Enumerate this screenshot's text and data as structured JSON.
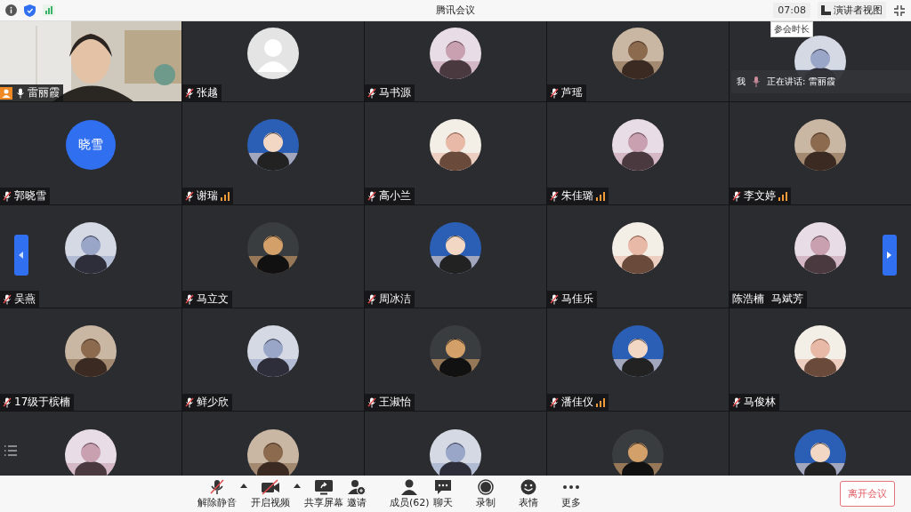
{
  "window": {
    "title": "腾讯会议",
    "timer": "07:08",
    "timer_tooltip": "参会时长",
    "view_button": "演讲者视图"
  },
  "participants": [
    {
      "name": "雷丽霞",
      "kind": "video",
      "muted": false,
      "host": true,
      "signal": false
    },
    {
      "name": "张越",
      "kind": "default",
      "muted": true,
      "host": false,
      "signal": false
    },
    {
      "name": "马书源",
      "kind": "picture",
      "muted": true,
      "host": false,
      "signal": false
    },
    {
      "name": "芦瑶",
      "kind": "picture",
      "muted": true,
      "host": false,
      "signal": false
    },
    {
      "kind": "picture"
    },
    {
      "name": "郭晓雪",
      "kind": "initials",
      "initials": "晓雪",
      "muted": true,
      "host": false,
      "signal": false
    },
    {
      "name": "谢瑞",
      "kind": "picture",
      "muted": true,
      "host": false,
      "signal": true
    },
    {
      "name": "高小兰",
      "kind": "picture",
      "muted": true,
      "host": false,
      "signal": false
    },
    {
      "name": "朱佳璐",
      "kind": "picture",
      "muted": true,
      "host": false,
      "signal": true
    },
    {
      "name": "李文婷",
      "kind": "picture",
      "muted": true,
      "host": false,
      "signal": true
    },
    {
      "name": "吴燕",
      "kind": "picture",
      "muted": true,
      "host": false,
      "signal": false
    },
    {
      "name": "马立文",
      "kind": "picture",
      "muted": true,
      "host": false,
      "signal": false
    },
    {
      "name": "周冰洁",
      "kind": "picture",
      "muted": true,
      "host": false,
      "signal": false
    },
    {
      "name": "马佳乐",
      "kind": "picture",
      "muted": true,
      "host": false,
      "signal": false
    },
    {
      "name": "陈浩楠  马斌芳",
      "kind": "picture",
      "host": false,
      "signal": false
    },
    {
      "name": "17级于槟楠",
      "kind": "picture",
      "muted": true,
      "host": false,
      "signal": false
    },
    {
      "name": "鲜少欣",
      "kind": "picture",
      "muted": true,
      "host": false,
      "signal": false
    },
    {
      "name": "王淑怡",
      "kind": "picture",
      "muted": true,
      "host": false,
      "signal": false
    },
    {
      "name": "潘佳仪",
      "kind": "picture",
      "muted": true,
      "host": false,
      "signal": true
    },
    {
      "name": "马俊林",
      "kind": "picture",
      "muted": true,
      "host": false,
      "signal": false
    },
    {
      "kind": "picture"
    },
    {
      "kind": "picture"
    },
    {
      "kind": "picture"
    },
    {
      "kind": "picture"
    },
    {
      "kind": "picture"
    }
  ],
  "speaking_popup": {
    "me": "我",
    "text": "正在讲话: 雷丽霞"
  },
  "toolbar": [
    {
      "kind": "mic",
      "label": "解除静音",
      "caret": true
    },
    {
      "kind": "video",
      "label": "开启视频",
      "caret": true
    },
    {
      "kind": "share",
      "label": "共享屏幕",
      "caret": false
    },
    {
      "kind": "invite",
      "label": "邀请",
      "caret": false
    },
    {
      "kind": "members",
      "label": "成员(62)",
      "caret": false
    },
    {
      "kind": "chat",
      "label": "聊天",
      "caret": false
    },
    {
      "kind": "record",
      "label": "录制",
      "caret": false
    },
    {
      "kind": "emoji",
      "label": "表情",
      "caret": false
    },
    {
      "kind": "more",
      "label": "更多",
      "caret": false
    }
  ],
  "leave_button": "离开会议"
}
